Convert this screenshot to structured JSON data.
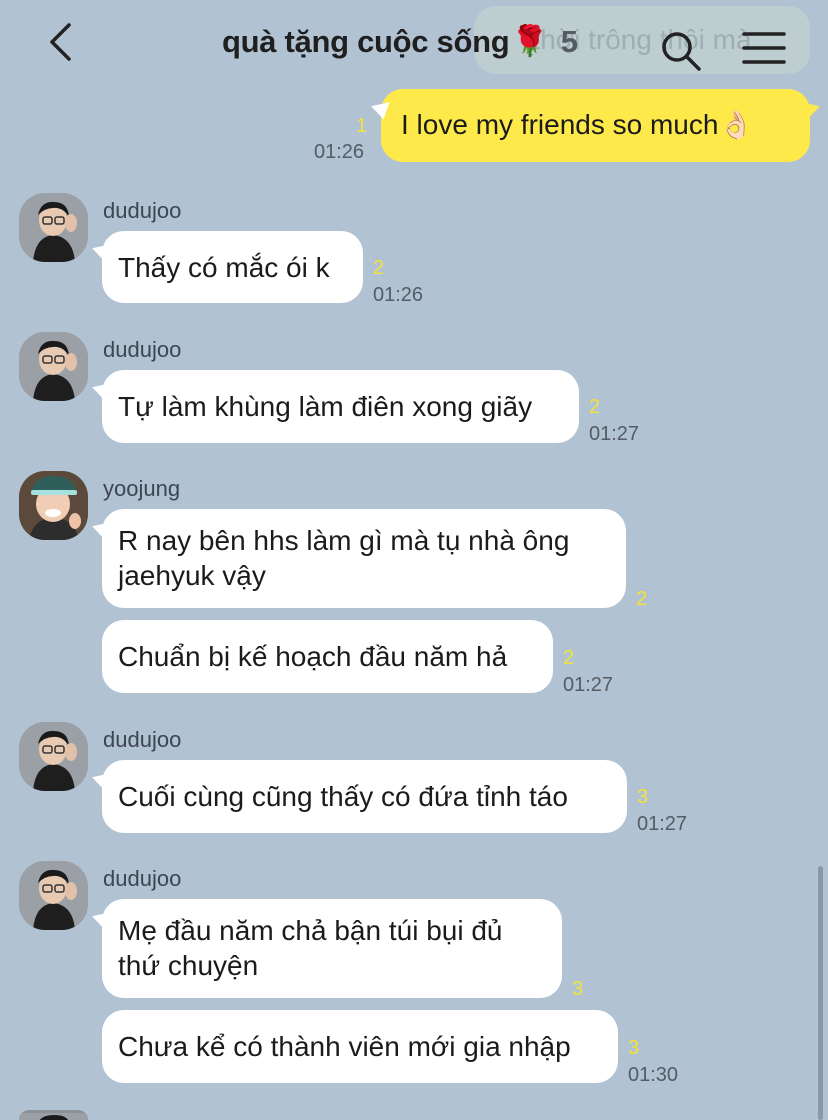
{
  "header": {
    "title": "quà tặng cuộc sống",
    "title_emoji": "🌹",
    "member_count": "5",
    "ghost_text": "thời trông thôi mà",
    "icons": {
      "back": "chevron-left-icon",
      "search": "search-icon",
      "menu": "hamburger-menu-icon"
    }
  },
  "messages": [
    {
      "type": "out",
      "text": "I love my friends so much👌🏻",
      "unread": "1",
      "time": "01:26"
    },
    {
      "type": "in",
      "sender": "dudujoo",
      "text": "Thấy có mắc ói k",
      "unread": "2",
      "time": "01:26"
    },
    {
      "type": "in",
      "sender": "dudujoo",
      "text": "Tự làm khùng làm điên xong giãy",
      "unread": "2",
      "time": "01:27"
    },
    {
      "type": "in",
      "sender": "yoojung",
      "text": "R nay bên hhs làm gì mà tụ nhà ông jaehyuk vậy",
      "unread": "2",
      "time": ""
    },
    {
      "type": "in",
      "sender": "yoojung",
      "text": "Chuẩn bị kế hoạch đầu năm hả",
      "unread": "2",
      "time": "01:27"
    },
    {
      "type": "in",
      "sender": "dudujoo",
      "text": "Cuối cùng cũng thấy có đứa tỉnh táo",
      "unread": "3",
      "time": "01:27"
    },
    {
      "type": "in",
      "sender": "dudujoo",
      "text": "Mẹ đầu năm chả bận túi bụi đủ thứ chuyện",
      "unread": "3",
      "time": ""
    },
    {
      "type": "in",
      "sender": "dudujoo",
      "text": "Chưa kể có thành viên mới gia nhập",
      "unread": "3",
      "time": "01:30"
    }
  ],
  "colors": {
    "background": "#b1c2d3",
    "outgoing_bubble": "#fee94b",
    "incoming_bubble": "#ffffff",
    "unread_count": "#f2e23a"
  }
}
